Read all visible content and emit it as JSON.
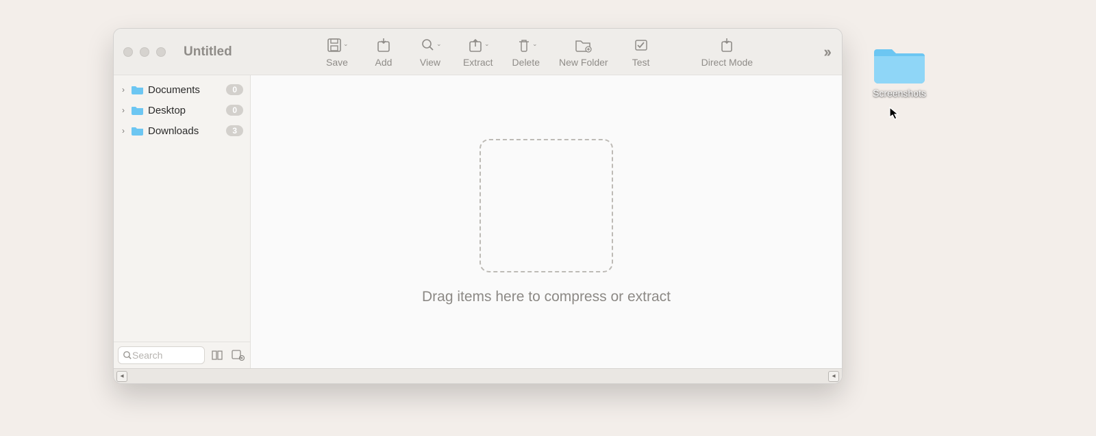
{
  "window": {
    "title": "Untitled"
  },
  "toolbar": {
    "save": "Save",
    "add": "Add",
    "view": "View",
    "extract": "Extract",
    "delete": "Delete",
    "new_folder": "New Folder",
    "test": "Test",
    "direct_mode": "Direct Mode"
  },
  "sidebar": {
    "items": [
      {
        "label": "Documents",
        "count": "0"
      },
      {
        "label": "Desktop",
        "count": "0"
      },
      {
        "label": "Downloads",
        "count": "3"
      }
    ],
    "search_placeholder": "Search"
  },
  "content": {
    "drop_hint": "Drag items here to compress or extract"
  },
  "desktop": {
    "folder_label": "Screenshots"
  }
}
